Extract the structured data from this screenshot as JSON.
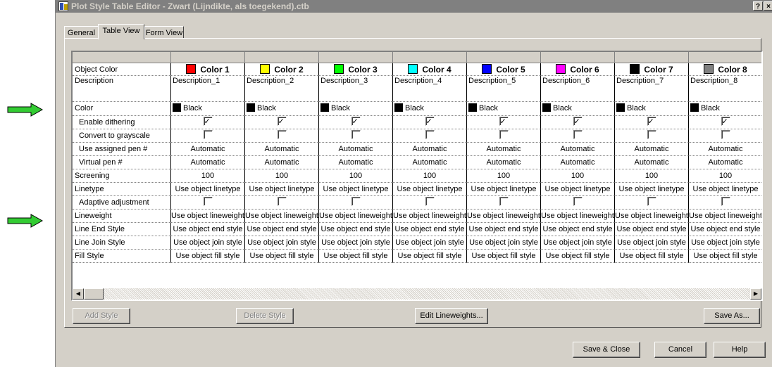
{
  "window": {
    "title": "Plot Style Table Editor - Zwart (Lijndikte, als toegekend).ctb",
    "help_btn": "?",
    "close_btn": "×"
  },
  "tabs": [
    {
      "label": "General",
      "active": false
    },
    {
      "label": "Table View",
      "active": true
    },
    {
      "label": "Form View",
      "active": false
    }
  ],
  "row_labels": {
    "object_color": "Object Color",
    "description": "Description",
    "color": "Color",
    "enable_dithering": "Enable dithering",
    "convert_grayscale": "Convert to grayscale",
    "use_assigned_pen": "Use assigned pen #",
    "virtual_pen": "Virtual pen #",
    "screening": "Screening",
    "linetype": "Linetype",
    "adaptive_adjustment": "Adaptive adjustment",
    "lineweight": "Lineweight",
    "line_end_style": "Line End Style",
    "line_join_style": "Line Join Style",
    "fill_style": "Fill Style"
  },
  "columns": [
    {
      "name": "Color 1",
      "swatch": "#ff0000",
      "description": "Description_1"
    },
    {
      "name": "Color 2",
      "swatch": "#ffff00",
      "description": "Description_2"
    },
    {
      "name": "Color 3",
      "swatch": "#00ff00",
      "description": "Description_3"
    },
    {
      "name": "Color 4",
      "swatch": "#00ffff",
      "description": "Description_4"
    },
    {
      "name": "Color 5",
      "swatch": "#0000ff",
      "description": "Description_5"
    },
    {
      "name": "Color 6",
      "swatch": "#ff00ff",
      "description": "Description_6"
    },
    {
      "name": "Color 7",
      "swatch": "#000000",
      "description": "Description_7"
    },
    {
      "name": "Color 8",
      "swatch": "#808080",
      "description": "Description_8"
    }
  ],
  "values": {
    "color": "Black",
    "enable_dithering": true,
    "convert_grayscale": false,
    "use_assigned_pen": "Automatic",
    "virtual_pen": "Automatic",
    "screening": "100",
    "linetype": "Use object linetype",
    "adaptive_adjustment": false,
    "lineweight": "Use object lineweight",
    "line_end_style": "Use object end style",
    "line_join_style": "Use object join style",
    "fill_style": "Use object fill style"
  },
  "buttons": {
    "add_style": "Add Style",
    "delete_style": "Delete Style",
    "edit_lineweights": "Edit Lineweights...",
    "save_as": "Save As...",
    "save_close": "Save & Close",
    "cancel": "Cancel",
    "help": "Help"
  },
  "colors": {
    "arrow": "#33cc33",
    "titlebar_inactive": "#808080",
    "dialog_face": "#d4d0c8"
  }
}
